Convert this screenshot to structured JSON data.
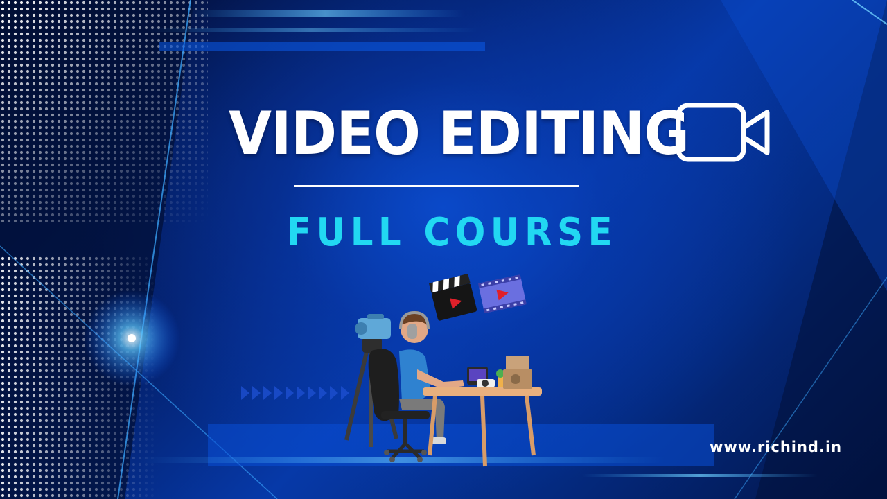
{
  "title": "VIDEO EDITING",
  "subtitle": "FULL COURSE",
  "website": "www.richind.in",
  "icons": {
    "title_icon": "video-camera-icon",
    "clapperboard": "clapperboard-icon",
    "film_play": "film-play-icon",
    "play_arrows": "play-arrows-icon"
  },
  "colors": {
    "background": "#0639a8",
    "title": "#ffffff",
    "subtitle": "#22d8f2",
    "accent_glow": "#2fa8ff"
  }
}
